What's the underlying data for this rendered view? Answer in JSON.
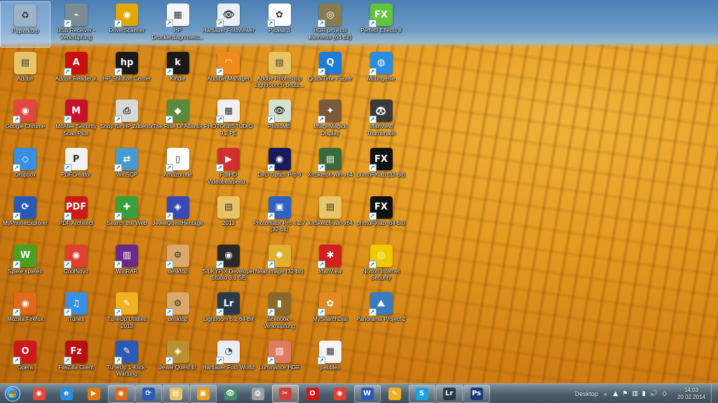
{
  "desktop_icons": [
    {
      "label": "Papierkorb",
      "icon": "recycle-bin-icon",
      "color": "#9ab4c8",
      "glyph": "♻",
      "col": 0,
      "row": 0,
      "selected": true
    },
    {
      "label": "USB Receiver - Verknüpfung",
      "icon": "usb-receiver-icon",
      "color": "#7d8b96",
      "glyph": "⌁",
      "col": 1,
      "row": 0
    },
    {
      "label": "DriverScanner",
      "icon": "driverscanner-icon",
      "color": "#e0a800",
      "glyph": "◉",
      "col": 2,
      "row": 0
    },
    {
      "label": "HP Druckerdiagnoseto...",
      "icon": "hp-printer-diagnostic-icon",
      "color": "#f5f5f5",
      "glyph": "▦",
      "col": 3,
      "row": 0
    },
    {
      "label": "Hartlauer Fotoviewer",
      "icon": "hartlauer-fotoviewer-icon",
      "color": "#e8eef6",
      "glyph": "👁",
      "col": 4,
      "row": 0
    },
    {
      "label": "Picasa 3",
      "icon": "picasa-icon",
      "color": "#ffffff",
      "glyph": "✿",
      "col": 5,
      "row": 0
    },
    {
      "label": "HDR projects elements (64-Bit)",
      "icon": "hdr-projects-icon",
      "color": "#8a7a50",
      "glyph": "◎",
      "col": 6,
      "row": 0
    },
    {
      "label": "Perfect Effects 8",
      "icon": "perfect-effects-icon",
      "color": "#62c43a",
      "glyph": "FX",
      "col": 7,
      "row": 0
    },
    {
      "label": "Adobe",
      "icon": "folder-icon",
      "color": "#e8c468",
      "glyph": "▤",
      "col": 0,
      "row": 1
    },
    {
      "label": "Adobe Reader X",
      "icon": "adobe-reader-icon",
      "color": "#c81010",
      "glyph": "A",
      "col": 1,
      "row": 1
    },
    {
      "label": "HP Solution Center",
      "icon": "hp-solution-center-icon",
      "color": "#1a1a1a",
      "glyph": "hp",
      "col": 2,
      "row": 1
    },
    {
      "label": "Kindle",
      "icon": "kindle-icon",
      "color": "#1a1a1a",
      "glyph": "k",
      "col": 3,
      "row": 1
    },
    {
      "label": "Audible Manager",
      "icon": "audible-manager-icon",
      "color": "#f08a1c",
      "glyph": "◠",
      "col": 4,
      "row": 1
    },
    {
      "label": "Adobe Photoshop Lightroom 5 deuts...",
      "icon": "folder-icon",
      "color": "#e8c468",
      "glyph": "▤",
      "col": 5,
      "row": 1
    },
    {
      "label": "QuickTime Player",
      "icon": "quicktime-icon",
      "color": "#1d7bd9",
      "glyph": "Q",
      "col": 6,
      "row": 1
    },
    {
      "label": "Mobogenie",
      "icon": "mobogenie-icon",
      "color": "#2a8de0",
      "glyph": "◍",
      "col": 7,
      "row": 1
    },
    {
      "label": "Google Chrome",
      "icon": "chrome-icon",
      "color": "#e2483d",
      "glyph": "◉",
      "col": 0,
      "row": 2
    },
    {
      "label": "McAfee Security Scan Plus",
      "icon": "mcafee-icon",
      "color": "#c8102e",
      "glyph": "M",
      "col": 1,
      "row": 2
    },
    {
      "label": "Shop für HP Zubehör",
      "icon": "hp-shop-icon",
      "color": "#d8d8d8",
      "glyph": "⎙",
      "col": 2,
      "row": 2
    },
    {
      "label": "The Rise Of Atlantis",
      "icon": "rise-of-atlantis-icon",
      "color": "#5a8a3a",
      "glyph": "◆",
      "col": 3,
      "row": 2
    },
    {
      "label": "PHOTOfunSTUDIO 9.2 PE",
      "icon": "photofunstudio-icon",
      "color": "#f0f0f0",
      "glyph": "▦",
      "col": 4,
      "row": 2
    },
    {
      "label": "PhotoME",
      "icon": "photome-icon",
      "color": "#d4e2d4",
      "glyph": "👁",
      "col": 5,
      "row": 2
    },
    {
      "label": "ImageMagick Display",
      "icon": "imagemagick-icon",
      "color": "#7a5a3a",
      "glyph": "✦",
      "col": 6,
      "row": 2
    },
    {
      "label": "IrfanView Thumbnails",
      "icon": "irfanview-thumbnails-icon",
      "color": "#3a3a3a",
      "glyph": "🐼",
      "col": 7,
      "row": 2
    },
    {
      "label": "Dropbox",
      "icon": "dropbox-icon",
      "color": "#3a8fe0",
      "glyph": "◇",
      "col": 0,
      "row": 3
    },
    {
      "label": "PDFCreator",
      "icon": "pdfcreator-icon",
      "color": "#f2f2f2",
      "glyph": "P",
      "col": 1,
      "row": 3
    },
    {
      "label": "WinSCP",
      "icon": "winscp-icon",
      "color": "#4a9ad0",
      "glyph": "⇄",
      "col": 2,
      "row": 3
    },
    {
      "label": "Amazon.de",
      "icon": "document-icon",
      "color": "#ffffff",
      "glyph": "▯",
      "col": 3,
      "row": 3
    },
    {
      "label": "FullHD Videobearbeitu...",
      "icon": "fullhd-video-icon",
      "color": "#d03030",
      "glyph": "▶",
      "col": 4,
      "row": 3
    },
    {
      "label": "DxO Optics Pro 9",
      "icon": "dxo-optics-icon",
      "color": "#1a1a5a",
      "glyph": "◉",
      "col": 5,
      "row": 3
    },
    {
      "label": "XnSketch-win-x64",
      "icon": "xnsketch-icon",
      "color": "#3a6a3a",
      "glyph": "▤",
      "col": 6,
      "row": 3
    },
    {
      "label": "photoFXlab (32-bit)",
      "icon": "photofxlab-icon",
      "color": "#111111",
      "glyph": "FX",
      "col": 7,
      "row": 3
    },
    {
      "label": "MyPhoneExplorer",
      "icon": "myphoneexplorer-icon",
      "color": "#2a5ab4",
      "glyph": "⟳",
      "col": 0,
      "row": 4
    },
    {
      "label": "PDF Architect",
      "icon": "pdf-architect-icon",
      "color": "#d01818",
      "glyph": "PDF",
      "col": 1,
      "row": 4
    },
    {
      "label": "Search the Web",
      "icon": "search-the-web-icon",
      "color": "#3aa03a",
      "glyph": "✚",
      "col": 2,
      "row": 4
    },
    {
      "label": "JewelQuestHeritage",
      "icon": "jewel-quest-heritage-icon",
      "color": "#3a4ab4",
      "glyph": "◈",
      "col": 3,
      "row": 4
    },
    {
      "label": "2013",
      "icon": "folder-icon",
      "color": "#e8c468",
      "glyph": "▤",
      "col": 4,
      "row": 4
    },
    {
      "label": "Photomatix Pro 4.2.7 (32-bit)",
      "icon": "photomatix-icon",
      "color": "#3060c0",
      "glyph": "▣",
      "col": 5,
      "row": 4
    },
    {
      "label": "XnSketch-win-x64",
      "icon": "folder-icon",
      "color": "#e8c468",
      "glyph": "▤",
      "col": 6,
      "row": 4
    },
    {
      "label": "photoFXlab (64-bit)",
      "icon": "photofxlab-icon",
      "color": "#111111",
      "glyph": "FX",
      "col": 7,
      "row": 4
    },
    {
      "label": "Spiele spielen",
      "icon": "wildtangent-games-icon",
      "color": "#4aa020",
      "glyph": "W",
      "col": 0,
      "row": 5
    },
    {
      "label": "CoolNovo",
      "icon": "coolnovo-icon",
      "color": "#e04030",
      "glyph": "◉",
      "col": 1,
      "row": 5
    },
    {
      "label": "WinRAR",
      "icon": "winrar-icon",
      "color": "#6a2a8a",
      "glyph": "▥",
      "col": 2,
      "row": 5
    },
    {
      "label": "desktop",
      "icon": "desktop-ini-icon",
      "color": "#d9a86a",
      "glyph": "⚙",
      "col": 3,
      "row": 5
    },
    {
      "label": "SILKYPIX Developer Studio 3.1 SE",
      "icon": "silkypix-icon",
      "color": "#2a2a2a",
      "glyph": "◉",
      "col": 4,
      "row": 5
    },
    {
      "label": "Neat Image (32-bit)",
      "icon": "neat-image-icon",
      "color": "#e0b030",
      "glyph": "✺",
      "col": 5,
      "row": 5
    },
    {
      "label": "IrfanView",
      "icon": "irfanview-icon",
      "color": "#d02020",
      "glyph": "✱",
      "col": 6,
      "row": 5
    },
    {
      "label": "Norton Internet Security",
      "icon": "norton-icon",
      "color": "#f0c800",
      "glyph": "◎",
      "col": 7,
      "row": 5
    },
    {
      "label": "Mozilla Firefox",
      "icon": "firefox-icon",
      "color": "#e06a1a",
      "glyph": "◉",
      "col": 0,
      "row": 6
    },
    {
      "label": "iTunes",
      "icon": "itunes-icon",
      "color": "#3a8fe0",
      "glyph": "♫",
      "col": 1,
      "row": 6
    },
    {
      "label": "TuneUp Utilities 2013",
      "icon": "tuneup-utilities-icon",
      "color": "#f0b020",
      "glyph": "✎",
      "col": 2,
      "row": 6
    },
    {
      "label": "desktop",
      "icon": "desktop-ini-icon",
      "color": "#d9a86a",
      "glyph": "⚙",
      "col": 3,
      "row": 6
    },
    {
      "label": "Lightroom 5.2 64-Bit",
      "icon": "lightroom-icon",
      "color": "#2a3a4a",
      "glyph": "Lr",
      "col": 4,
      "row": 6
    },
    {
      "label": "facebook - Verknüpfung",
      "icon": "facebook-shortcut-icon",
      "color": "#8a6a2a",
      "glyph": "▮",
      "col": 5,
      "row": 6
    },
    {
      "label": "MySearchDial",
      "icon": "mysearchdial-icon",
      "color": "#e08a20",
      "glyph": "✿",
      "col": 6,
      "row": 6
    },
    {
      "label": "Panorama Project 2",
      "icon": "panorama-project-icon",
      "color": "#3a7ac0",
      "glyph": "⛰",
      "col": 7,
      "row": 6
    },
    {
      "label": "Opera",
      "icon": "opera-icon",
      "color": "#d01818",
      "glyph": "O",
      "col": 0,
      "row": 7
    },
    {
      "label": "FileZilla Client",
      "icon": "filezilla-icon",
      "color": "#b81010",
      "glyph": "Fz",
      "col": 1,
      "row": 7
    },
    {
      "label": "TuneUp 1-Klick-Wartung",
      "icon": "tuneup-1-klick-icon",
      "color": "#2a5ab4",
      "glyph": "✎",
      "col": 2,
      "row": 7
    },
    {
      "label": "Jewel Quest III",
      "icon": "jewel-quest-3-icon",
      "color": "#b89030",
      "glyph": "◈",
      "col": 3,
      "row": 7
    },
    {
      "label": "Hartlauer Foto World",
      "icon": "hartlauer-foto-world-icon",
      "color": "#e8eef6",
      "glyph": "◔",
      "col": 4,
      "row": 7
    },
    {
      "label": "Luminance HDR",
      "icon": "luminance-hdr-icon",
      "color": "#e07a60",
      "glyph": "▧",
      "col": 5,
      "row": 7
    },
    {
      "label": "pebbles",
      "icon": "spreadsheet-file-icon",
      "color": "#f4f4f4",
      "glyph": "▦",
      "col": 6,
      "row": 7
    }
  ],
  "taskbar": {
    "start_label": "Start",
    "items": [
      {
        "name": "chrome",
        "icon": "chrome-icon",
        "color": "#e2483d",
        "glyph": "◉",
        "state": "pinned"
      },
      {
        "name": "internet-explorer",
        "icon": "internet-explorer-icon",
        "color": "#2a8de0",
        "glyph": "e",
        "state": "pinned"
      },
      {
        "name": "media-player",
        "icon": "media-player-icon",
        "color": "#e07a10",
        "glyph": "▶",
        "state": "pinned"
      },
      {
        "name": "firefox",
        "icon": "firefox-icon",
        "color": "#e06a1a",
        "glyph": "◉",
        "state": "running"
      },
      {
        "name": "myphoneexplorer",
        "icon": "myphoneexplorer-icon",
        "color": "#2a5ab4",
        "glyph": "⟳",
        "state": "running"
      },
      {
        "name": "explorer",
        "icon": "folder-icon",
        "color": "#e8c468",
        "glyph": "▤",
        "state": "running"
      },
      {
        "name": "hartlauer",
        "icon": "photo-app-icon",
        "color": "#e8a020",
        "glyph": "▣",
        "state": "running"
      },
      {
        "name": "photome",
        "icon": "eye-icon",
        "color": "#4a8a6a",
        "glyph": "👁",
        "state": "pinned"
      },
      {
        "name": "hp-shop",
        "icon": "printer-icon",
        "color": "#a0a0a0",
        "glyph": "⎙",
        "state": "pinned"
      },
      {
        "name": "snipping",
        "icon": "scissors-icon",
        "color": "#d04040",
        "glyph": "✂",
        "state": "active"
      },
      {
        "name": "opera",
        "icon": "opera-icon",
        "color": "#d01818",
        "glyph": "O",
        "state": "pinned"
      },
      {
        "name": "coolnovo",
        "icon": "coolnovo-icon",
        "color": "#e04030",
        "glyph": "◉",
        "state": "pinned"
      },
      {
        "name": "word",
        "icon": "word-icon",
        "color": "#2a5ab4",
        "glyph": "W",
        "state": "running"
      },
      {
        "name": "tuneup",
        "icon": "tuneup-icon",
        "color": "#f0b020",
        "glyph": "✎",
        "state": "pinned"
      },
      {
        "name": "skype",
        "icon": "skype-icon",
        "color": "#1ea0e0",
        "glyph": "S",
        "state": "running"
      },
      {
        "name": "lightroom",
        "icon": "lightroom-icon",
        "color": "#2a3a4a",
        "glyph": "Lr",
        "state": "running"
      },
      {
        "name": "photoshop",
        "icon": "photoshop-icon",
        "color": "#1a3a7a",
        "glyph": "Ps",
        "state": "running"
      }
    ],
    "tray": {
      "desktop_label": "Desktop",
      "chevron": "»",
      "icons": [
        {
          "name": "show-hidden-icons",
          "glyph": "▲"
        },
        {
          "name": "flag-icon",
          "glyph": "⚑"
        },
        {
          "name": "network-icon",
          "glyph": "▥"
        },
        {
          "name": "battery-icon",
          "glyph": "▮"
        },
        {
          "name": "volume-icon",
          "glyph": "🔊"
        },
        {
          "name": "dropbox-tray-icon",
          "glyph": "◇"
        }
      ],
      "time": "14:03",
      "date": "20.02.2014"
    }
  }
}
